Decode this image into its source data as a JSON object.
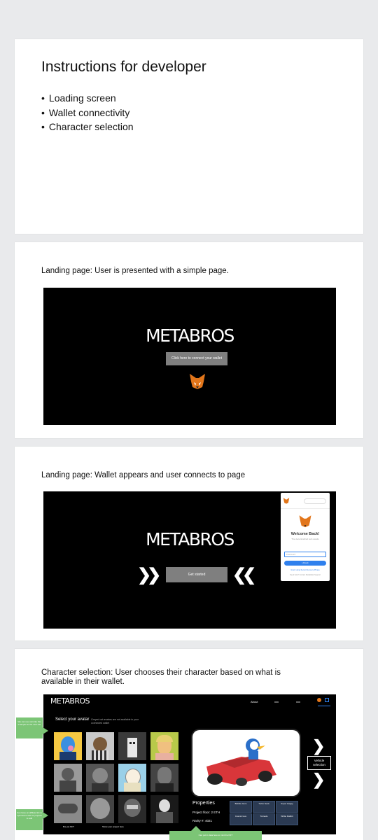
{
  "page1": {
    "title": "Instructions for developer",
    "bullets": [
      "Loading screen",
      "Wallet connectivity",
      "Character selection"
    ]
  },
  "page2": {
    "caption": "Landing page: User is presented with a simple page.",
    "logo": "METABROS",
    "connect_button": "Click here to connect your wallet",
    "fox": "metamask-fox-icon"
  },
  "page3": {
    "caption": "Landing page: Wallet appears and user connects to page",
    "logo": "METABROS",
    "get_started": "Get started",
    "metamask": {
      "welcome": "Welcome Back!",
      "subtitle": "The decentralized web awaits",
      "password_placeholder": "Password",
      "unlock": "Unlock",
      "link": "Import using Secret Recovery Phrase",
      "help": "Need help? Contact MetaMask Support"
    }
  },
  "page4": {
    "caption": "Character selection: User chooses their character based on what is available in their wallet.",
    "logo": "METABROS",
    "nav": [
      "About",
      "xxx",
      "xxx"
    ],
    "select_title": "Select your avatar",
    "greyed_note": "Greyed out avatars are not available in your connected wallet",
    "vehicle_button": "Vehicle selection",
    "properties_title": "Properties",
    "project_floor": "Project floor: 2 ETH",
    "rarity": "Rarity #: 4021",
    "prop_boxes": [
      {
        "label": "",
        "value": "Bubble Gum"
      },
      {
        "label": "",
        "value": "Turbo Neck"
      },
      {
        "label": "",
        "value": "Super Happy"
      },
      {
        "label": "",
        "value": "Cosmic love"
      },
      {
        "label": "",
        "value": "Tornado"
      },
      {
        "label": "",
        "value": "White Rabbit"
      }
    ],
    "buy_nft": "Buy an NFT",
    "show_project": "Show your project here",
    "note_left_top": "We can use cars like this example for the mint site",
    "note_left_bottom": "Can have an affiliate link to opensea ie link for projects to add",
    "note_bottom": "Can put in data here to mint the NFT"
  }
}
